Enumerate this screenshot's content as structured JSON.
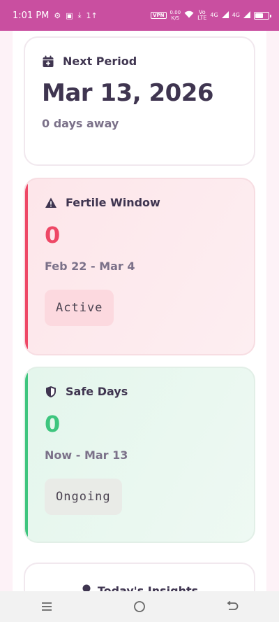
{
  "status": {
    "time": "1:01 PM",
    "vpn": "VPN",
    "speed_value": "0.00",
    "speed_unit": "K/S",
    "net1_top": "Vo",
    "net1_bottom": "LTE",
    "net2": "4G",
    "net3": "4G"
  },
  "next_period": {
    "title": "Next Period",
    "date": "Mar 13, 2026",
    "days_away": "0 days away"
  },
  "fertile": {
    "title": "Fertile Window",
    "count": "0",
    "range": "Feb 22 - Mar 4",
    "status": "Active",
    "accent": "#ee4866"
  },
  "safe": {
    "title": "Safe Days",
    "count": "0",
    "range": "Now - Mar 13",
    "status": "Ongoing",
    "accent": "#3ec57e"
  },
  "insights": {
    "title": "Today's Insights"
  },
  "icons": {
    "next_period": "calendar-plus-icon",
    "fertile": "warning-icon",
    "safe": "shield-icon"
  }
}
